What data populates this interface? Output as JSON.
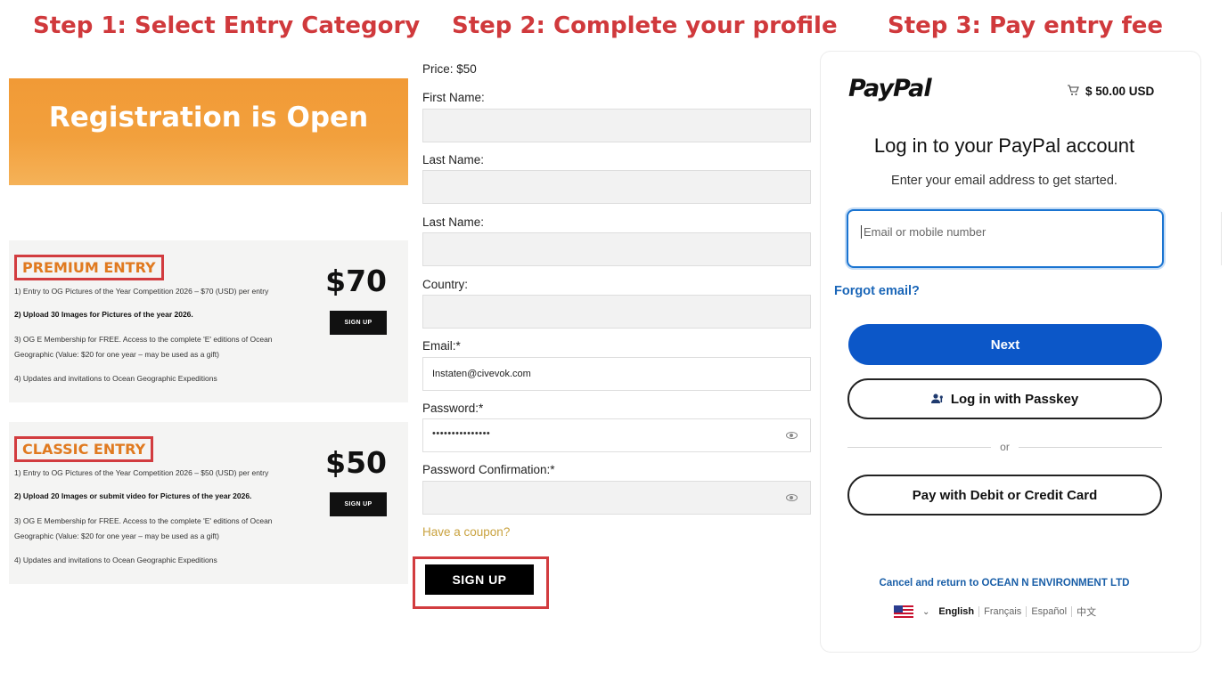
{
  "steps": {
    "step1": "Step 1: Select Entry Category",
    "step2": "Step 2: Complete your profile",
    "step3": "Step 3: Pay entry fee"
  },
  "panel1": {
    "banner": "Registration is Open",
    "premium": {
      "title": "PREMIUM ENTRY",
      "price": "$70",
      "signup": "SIGN UP",
      "lines": [
        "1) Entry to OG Pictures of the Year Competition 2026 – $70 (USD) per entry",
        "2) Upload 30 Images for Pictures of the year 2026.",
        "3) OG E Membership for FREE. Access to the complete 'E' editions of Ocean",
        "Geographic (Value: $20 for one year – may be used as a gift)",
        "4) Updates and invitations to Ocean Geographic Expeditions"
      ]
    },
    "classic": {
      "title": "CLASSIC ENTRY",
      "price": "$50",
      "signup": "SIGN UP",
      "lines": [
        "1) Entry to OG Pictures of the Year Competition 2026 – $50 (USD) per entry",
        "2) Upload 20 Images or submit video for Pictures of the year 2026.",
        "3) OG E Membership for FREE. Access to the complete 'E' editions of Ocean",
        "Geographic (Value: $20 for one year – may be used as a gift)",
        "4) Updates and invitations to Ocean Geographic Expeditions"
      ]
    }
  },
  "panel2": {
    "price": "Price: $50",
    "first_name_label": "First Name:",
    "last_name_label": "Last Name:",
    "last_name_label_2": "Last Name:",
    "country_label": "Country:",
    "email_label": "Email:*",
    "email_value": "Instaten@civevok.com",
    "password_label": "Password:*",
    "password_value": "•••••••••••••••",
    "password_confirm_label": "Password Confirmation:*",
    "coupon": "Have a coupon?",
    "signup": "SIGN UP"
  },
  "panel3": {
    "logo": "PayPal",
    "amount": "$ 50.00 USD",
    "title": "Log in to your PayPal account",
    "subtitle": "Enter your email address to get started.",
    "email_placeholder": "Email or mobile number",
    "forgot": "Forgot email?",
    "next": "Next",
    "passkey": "Log in with Passkey",
    "or": "or",
    "card": "Pay with Debit or Credit Card",
    "cancel": "Cancel and return to OCEAN N ENVIRONMENT LTD",
    "languages": [
      "English",
      "Français",
      "Español",
      "中文"
    ]
  },
  "colors": {
    "step_title": "#d0393c",
    "highlight_box": "#d23c3f",
    "entry_title": "#e07a20",
    "banner": "#f2a03d",
    "paypal_blue": "#0c57c8",
    "link_blue": "#1a66b8"
  },
  "icons": [
    "cart-icon",
    "eye-icon",
    "passkey-icon",
    "us-flag-icon",
    "chevron-down-icon"
  ]
}
